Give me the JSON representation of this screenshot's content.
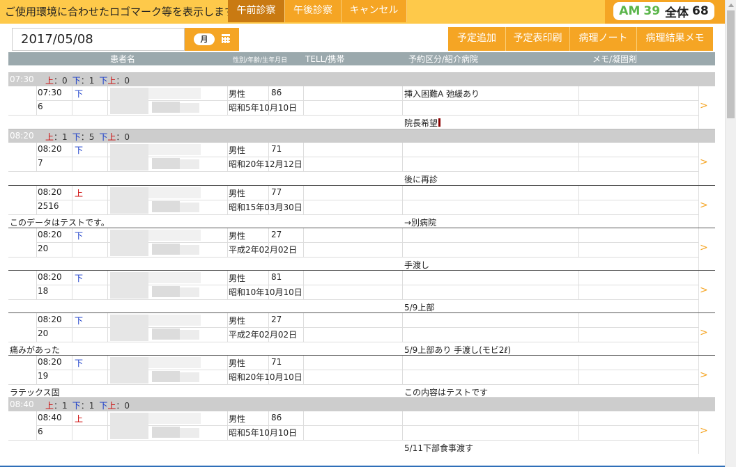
{
  "header": {
    "logo_text": "ご使用環境に合わせたロゴマーク等を表示します。",
    "tabs": [
      {
        "label": "午前診察",
        "active": true
      },
      {
        "label": "午後診察",
        "active": false
      },
      {
        "label": "キャンセル",
        "active": false
      }
    ],
    "counter": {
      "am_label": "AM",
      "am_count": "39",
      "all_label": "全体",
      "all_count": "68"
    }
  },
  "toolbar": {
    "date": "2017/05/08",
    "weekday": "月",
    "calendar_icon": "calendar-icon",
    "actions": [
      "予定追加",
      "予定表印刷",
      "病理ノート",
      "病理結果メモ"
    ]
  },
  "columns": {
    "name": "患者名",
    "sex_age_birth": "性別/年齢/生年月日",
    "tel": "TELL/携帯",
    "reservation": "予約区分/紹介病院",
    "memo": "メモ/凝固剤"
  },
  "colors": {
    "accent": "#f5a524",
    "header_bg": "#fec94a",
    "up": "#cc0000",
    "down": "#1438c8",
    "am": "#5ab54a"
  },
  "labels": {
    "up": "上",
    "down": "下",
    "colon": "：",
    "arrow": ">"
  },
  "groups": [
    {
      "time": "07:30",
      "up": "0",
      "down": "1",
      "downup": "0",
      "records": [
        {
          "time": "07:30",
          "kind": "下",
          "num": "6",
          "sex": "男性",
          "age": "86",
          "birth": "昭和5年10月10日",
          "reservation": "挿入困難A 弛緩あり",
          "left_note": "",
          "bottom_note": "院長希望"
        }
      ]
    },
    {
      "time": "08:20",
      "up": "1",
      "down": "5",
      "downup": "0",
      "records": [
        {
          "time": "08:20",
          "kind": "下",
          "num": "7",
          "sex": "男性",
          "age": "71",
          "birth": "昭和20年12月12日",
          "reservation": "",
          "left_note": "",
          "bottom_note": "後に再診"
        },
        {
          "time": "08:20",
          "kind": "上",
          "num": "2516",
          "sex": "男性",
          "age": "77",
          "birth": "昭和15年03月30日",
          "reservation": "",
          "left_note": "このデータはテストです。",
          "bottom_note": "→別病院"
        },
        {
          "time": "08:20",
          "kind": "下",
          "num": "20",
          "sex": "男性",
          "age": "27",
          "birth": "平成2年02月02日",
          "reservation": "",
          "left_note": "",
          "bottom_note": "手渡し"
        },
        {
          "time": "08:20",
          "kind": "下",
          "num": "18",
          "sex": "男性",
          "age": "81",
          "birth": "昭和10年10月10日",
          "reservation": "",
          "left_note": "",
          "bottom_note": "5/9上部"
        },
        {
          "time": "08:20",
          "kind": "下",
          "num": "20",
          "sex": "男性",
          "age": "27",
          "birth": "平成2年02月02日",
          "reservation": "",
          "left_note": "痛みがあった",
          "bottom_note": "5/9上部あり 手渡し(モビ2ℓ)"
        },
        {
          "time": "08:20",
          "kind": "下",
          "num": "19",
          "sex": "男性",
          "age": "71",
          "birth": "昭和20年10月10日",
          "reservation": "",
          "left_note": "ラテックス固",
          "bottom_note": "この内容はテストです"
        }
      ]
    },
    {
      "time": "08:40",
      "up": "1",
      "down": "1",
      "downup": "0",
      "records": [
        {
          "time": "08:40",
          "kind": "上",
          "num": "6",
          "sex": "男性",
          "age": "86",
          "birth": "昭和5年10月10日",
          "reservation": "",
          "left_note": "",
          "bottom_note": "5/11下部食事渡す"
        }
      ]
    }
  ]
}
